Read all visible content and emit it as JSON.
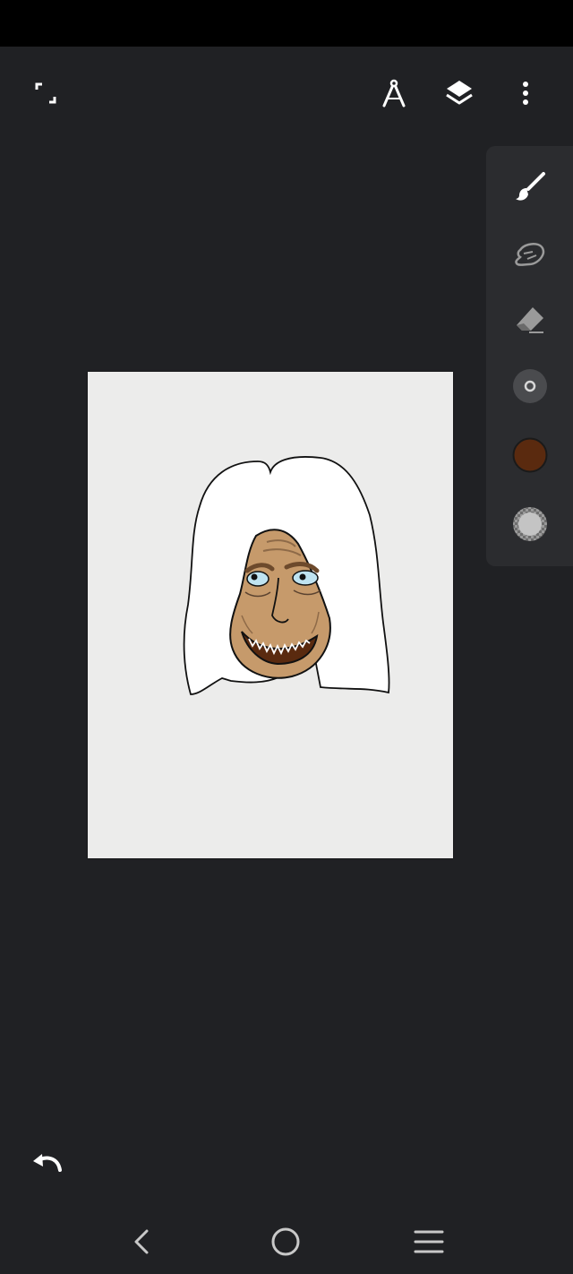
{
  "app": {
    "top_toolbar": {
      "icons": [
        "fullscreen-icon",
        "ruler-compass-icon",
        "layers-icon",
        "more-vert-icon"
      ]
    },
    "side_toolbar": {
      "tools": [
        "brush-icon",
        "smudge-icon",
        "eraser-icon",
        "brush-size-icon",
        "color-swatch-icon",
        "opacity-icon"
      ],
      "current_color": "#5a2a0f",
      "brush_size_color": "#d7d7d7",
      "opacity_color": "#bdbdbd"
    },
    "canvas": {
      "background": "#ececeb",
      "hair_color": "#ffffff",
      "skin_color": "#c69a6b",
      "eye_color": "#bfe3f1",
      "mouth_color": "#5a2a0f"
    },
    "bottom": {
      "undo": "undo-icon"
    },
    "system_nav": {
      "buttons": [
        "back-icon",
        "home-icon",
        "recents-icon"
      ]
    }
  }
}
